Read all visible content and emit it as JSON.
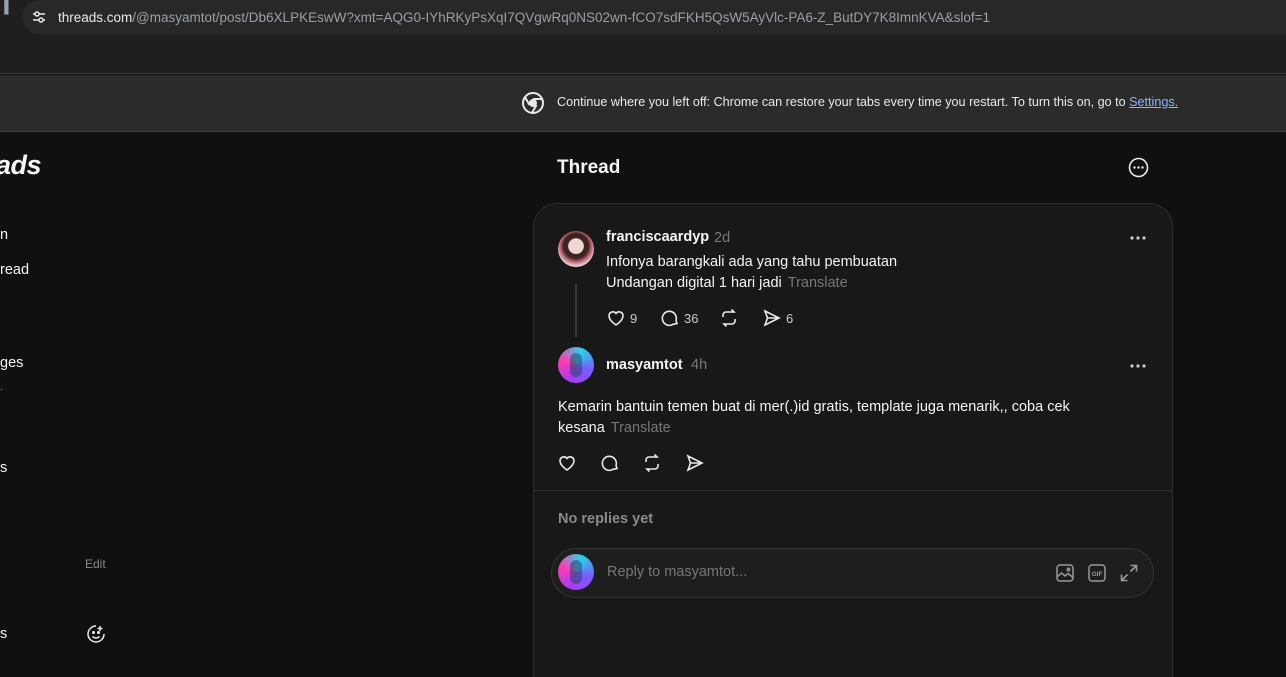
{
  "browser": {
    "edge_glyph": "▐",
    "url_host": "threads.com",
    "url_path": "/@masyamtot/post/Db6XLPKEswW?xmt=AQG0-IYhRKyPsXqI7QVgwRq0NS02wn-fCO7sdFKH5QsW5AyVlc-PA6-Z_ButDY7K8ImnKVA&slof=1",
    "site_info_icon": "tune-icon",
    "infobar_icon": "chrome-logo-icon",
    "infobar_text": "Continue where you left off: Chrome can restore your tabs every time you restart. To turn this on, go to ",
    "infobar_link": "Settings."
  },
  "sidebar": {
    "logo_fragment": "ads",
    "fragments": [
      "n",
      "read",
      "ges",
      "·",
      "s",
      "s"
    ],
    "edit_label": "Edit",
    "emoji_icon": "emoji-feedback-icon"
  },
  "header": {
    "title": "Thread",
    "more_icon": "more-circle-icon"
  },
  "parent_post": {
    "username": "franciscaardyp",
    "time": "2d",
    "line1": "Infonya barangkali ada yang tahu pembuatan",
    "line2": "Undangan digital 1 hari jadi",
    "translate": "Translate",
    "likes": "9",
    "replies": "36",
    "shares": "6"
  },
  "main_post": {
    "username": "masyamtot",
    "time": "4h",
    "line1": "Kemarin bantuin temen buat di mer(.)id gratis, template juga menarik,, coba cek",
    "line2": "kesana",
    "translate": "Translate"
  },
  "replies": {
    "empty_label": "No replies yet"
  },
  "reply_box": {
    "placeholder": "Reply to masyamtot...",
    "icons": [
      "image-icon",
      "gif-icon",
      "expand-icon"
    ]
  },
  "colors": {
    "background": "#101010",
    "card": "#181818",
    "link": "#8ab4f8",
    "muted": "#777777"
  }
}
